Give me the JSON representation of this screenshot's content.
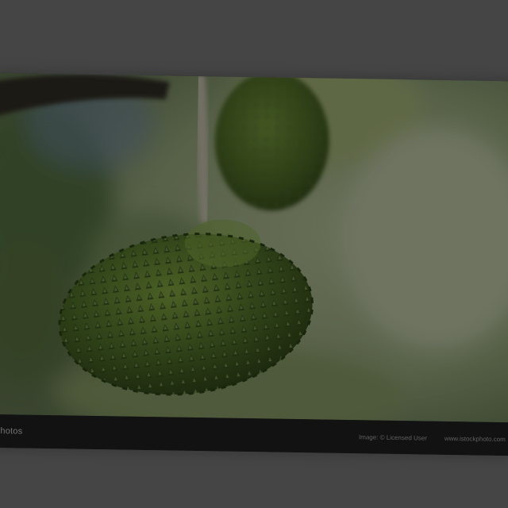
{
  "caption": {
    "left_text": "Photos",
    "credit_text": "Image: © Licensed User",
    "link_text": "www.istockphoto.com"
  },
  "photo": {
    "subject": "durian fruit hanging from branch",
    "colors": {
      "background_blur": "#7f8f72",
      "fruit_green": "#4f6e2b",
      "fruit_dark": "#2d4216",
      "stem": "#b7b2a0",
      "caption_bar": "#1d1d1d"
    }
  }
}
